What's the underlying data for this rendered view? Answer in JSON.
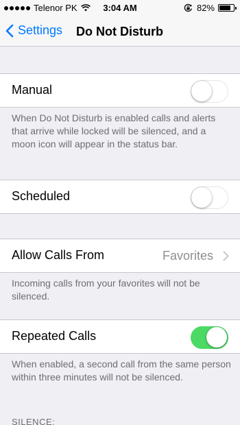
{
  "status_bar": {
    "carrier": "Telenor PK",
    "time": "3:04 AM",
    "battery_percent": "82%",
    "battery_level": 0.82,
    "signal_icon": "signal-dots-icon",
    "wifi_icon": "wifi-icon",
    "rotation_lock_icon": "rotation-lock-icon"
  },
  "nav": {
    "back_label": "Settings",
    "title": "Do Not Disturb"
  },
  "manual": {
    "label": "Manual",
    "enabled": false,
    "footer": "When Do Not Disturb is enabled calls and alerts that arrive while locked will be silenced, and a moon icon will appear in the status bar."
  },
  "scheduled": {
    "label": "Scheduled",
    "enabled": false
  },
  "allow_calls": {
    "label": "Allow Calls From",
    "value": "Favorites",
    "footer": "Incoming calls from your favorites will not be silenced."
  },
  "repeated_calls": {
    "label": "Repeated Calls",
    "enabled": true,
    "footer": "When enabled, a second call from the same person within three minutes will not be silenced."
  },
  "silence": {
    "header": "SILENCE:"
  },
  "colors": {
    "accent": "#007aff",
    "toggle_on": "#4cd964",
    "background": "#efeff4"
  }
}
